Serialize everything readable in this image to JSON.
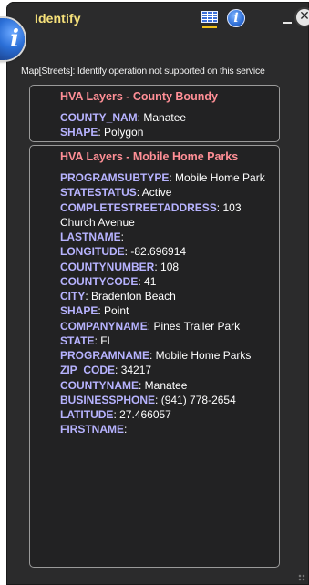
{
  "window": {
    "title": "Identify",
    "icons": [
      "info-icon",
      "table-icon",
      "minimize-icon",
      "close-icon"
    ],
    "close_glyph": "✕",
    "info_glyph": "i",
    "panel_icon_glyph": "i"
  },
  "message": "Map[Streets]: Identify operation not supported on this service",
  "results": [
    {
      "layer": "HVA Layers - County Boundy",
      "attributes": [
        {
          "key": "COUNTY_NAM",
          "value": "Manatee"
        },
        {
          "key": "SHAPE",
          "value": "Polygon"
        }
      ]
    },
    {
      "layer": "HVA Layers - Mobile Home Parks",
      "attributes": [
        {
          "key": "PROGRAMSUBTYPE",
          "value": "Mobile Home Park"
        },
        {
          "key": "STATESTATUS",
          "value": "Active"
        },
        {
          "key": "COMPLETESTREETADDRESS",
          "value": "103 Church Avenue"
        },
        {
          "key": "LASTNAME",
          "value": ""
        },
        {
          "key": "LONGITUDE",
          "value": "-82.696914"
        },
        {
          "key": "COUNTYNUMBER",
          "value": "108"
        },
        {
          "key": "COUNTYCODE",
          "value": "41"
        },
        {
          "key": "CITY",
          "value": "Bradenton Beach"
        },
        {
          "key": "SHAPE",
          "value": "Point"
        },
        {
          "key": "COMPANYNAME",
          "value": "Pines Trailer Park"
        },
        {
          "key": "STATE",
          "value": "FL"
        },
        {
          "key": "PROGRAMNAME",
          "value": "Mobile Home Parks"
        },
        {
          "key": "ZIP_CODE",
          "value": "34217"
        },
        {
          "key": "COUNTYNAME",
          "value": "Manatee"
        },
        {
          "key": "BUSINESSPHONE",
          "value": "(941) 778-2654"
        },
        {
          "key": "LATITUDE",
          "value": "27.466057"
        },
        {
          "key": "FIRSTNAME",
          "value": ""
        }
      ]
    }
  ],
  "colors": {
    "panel": "#2b2b2c",
    "title": "#f6e17a",
    "layer_title": "#ff8f96",
    "attr_key": "#b7b3ff"
  }
}
